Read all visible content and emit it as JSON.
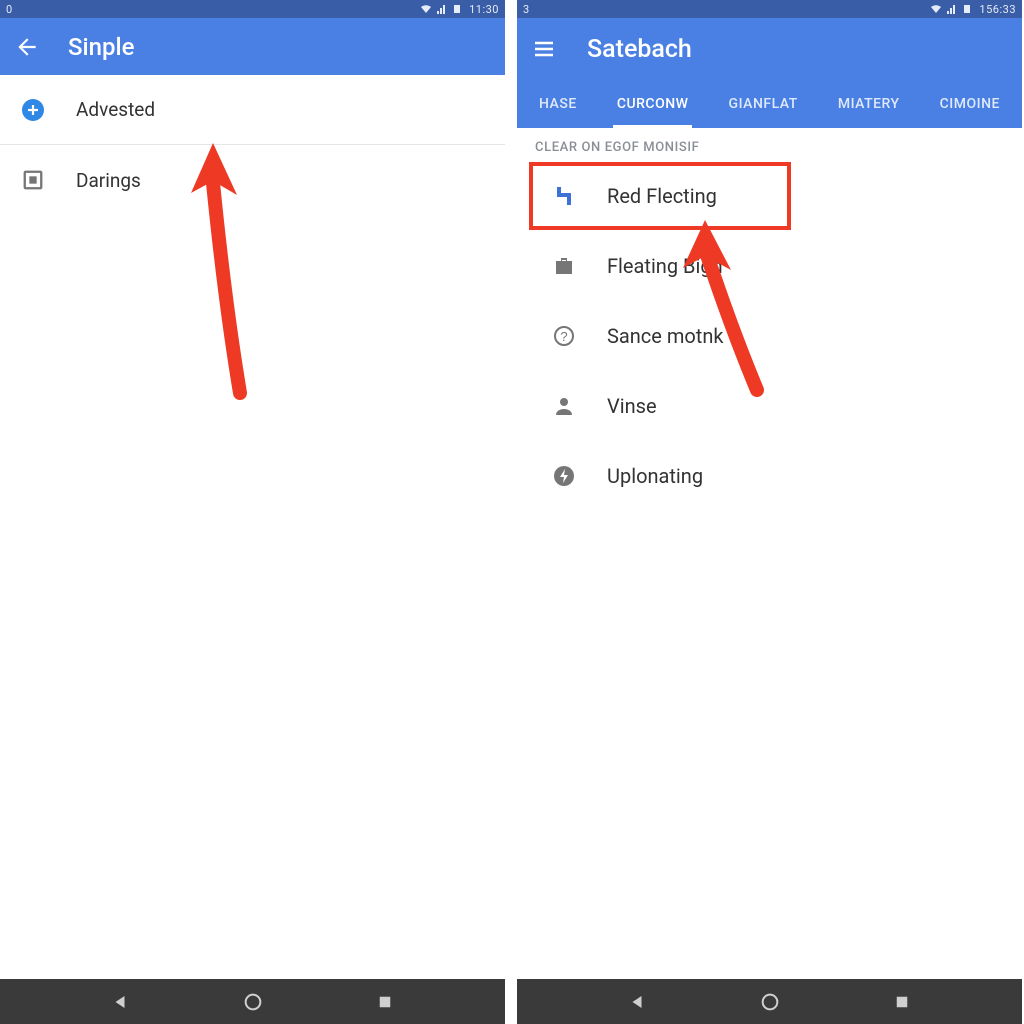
{
  "colors": {
    "primary": "#4a80e4",
    "primary_dark": "#3a5da8",
    "highlight": "#ee3a24",
    "icon_grey": "#767676",
    "navbar": "#3a3a3a"
  },
  "left": {
    "status": {
      "left_text": "0",
      "right_text": "11:30"
    },
    "appbar": {
      "nav_icon": "back-arrow",
      "title": "Sinple"
    },
    "rows": [
      {
        "icon": "plus-circle",
        "label": "Advested",
        "divider": true
      },
      {
        "icon": "square-outline",
        "label": "Darings",
        "divider": false
      }
    ],
    "annotation_arrow": {
      "icon": "arrow-red"
    }
  },
  "right": {
    "status": {
      "left_text": "3",
      "right_text": "156:33"
    },
    "appbar": {
      "nav_icon": "hamburger",
      "title": "Satebach"
    },
    "tabs": [
      {
        "label": "HASE",
        "active": false
      },
      {
        "label": "CURCONW",
        "active": true
      },
      {
        "label": "GIANFLAT",
        "active": false
      },
      {
        "label": "MIATERY",
        "active": false
      },
      {
        "label": "CIMOINE",
        "active": false
      }
    ],
    "section_caption": "CLEAR ON EGOF MONISIF",
    "rows": [
      {
        "icon": "flag-shape",
        "label": "Red Flecting",
        "highlighted": true
      },
      {
        "icon": "briefcase",
        "label": "Fleating Bigh"
      },
      {
        "icon": "help-circle",
        "label": "Sance motnk"
      },
      {
        "icon": "person",
        "label": "Vinse"
      },
      {
        "icon": "bolt-circle",
        "label": "Uplonating"
      }
    ],
    "annotation_arrow": {
      "icon": "arrow-red"
    }
  },
  "navbar_keys": [
    "back-triangle",
    "home-circle",
    "recent-square"
  ]
}
